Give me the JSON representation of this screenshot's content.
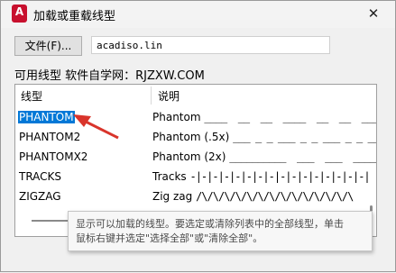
{
  "window": {
    "title": "加载或重载线型",
    "app_icon_letter": "A",
    "close_glyph": "✕"
  },
  "file": {
    "button_label": "文件(F)...",
    "value": "acadiso.lin"
  },
  "available_label": "可用线型 软件自学网：RJZXW.COM",
  "list": {
    "headers": {
      "name": "线型",
      "desc": "说明"
    },
    "rows": [
      {
        "name": "PHANTOM",
        "label": "Phantom ",
        "pattern": "____  __  __  ____  __  __  ____",
        "selected": true
      },
      {
        "name": "PHANTOM2",
        "label": "Phantom (.5x) ",
        "pattern": "___ _ _ ___ _ _ ___ _ _ ___ _ _",
        "selected": false
      },
      {
        "name": "PHANTOMX2",
        "label": "Phantom (2x) ",
        "pattern": "__________  ___  ___  _____",
        "selected": false
      },
      {
        "name": "TRACKS",
        "label": "Tracks ",
        "pattern": "-|-|-|-|-|-|-|-|-|-|-|-|-|-|-|-|",
        "selected": false
      },
      {
        "name": "ZIGZAG",
        "label": "Zig zag ",
        "pattern": "/\\/\\/\\/\\/\\/\\/\\/\\/\\/\\/\\/\\/\\/\\",
        "selected": false
      }
    ]
  },
  "tooltip": {
    "line1": "显示可以加载的线型。要选定或清除列表中的全部线型，单击",
    "line2": "鼠标右键并选定\"选择全部\"或\"清除全部\"。"
  },
  "colors": {
    "selection": "#0078d7",
    "arrow": "#d9342b",
    "app_icon": "#c8102e"
  }
}
